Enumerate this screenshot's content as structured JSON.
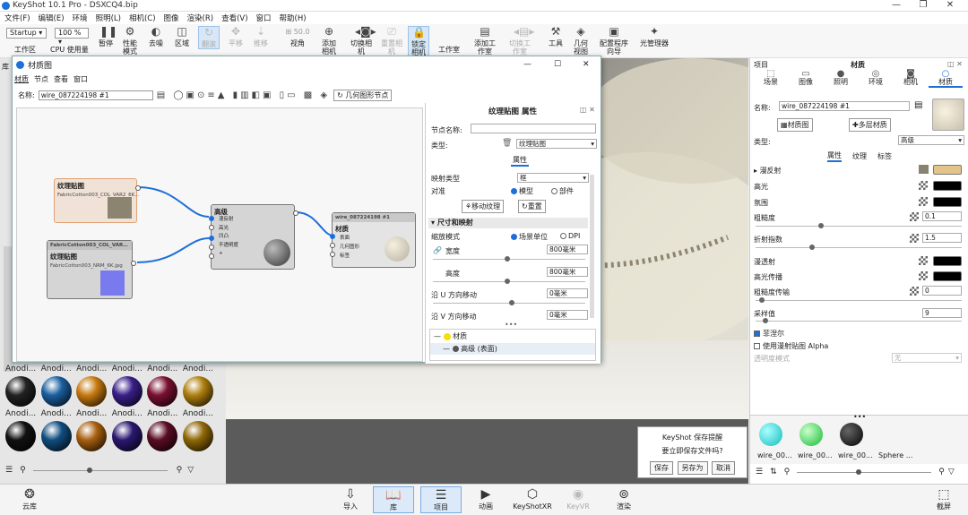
{
  "app": {
    "title": "KeyShot 10.1 Pro - DSXCQ4.bip"
  },
  "menu": [
    "文件(F)",
    "编辑(E)",
    "环境",
    "照明(L)",
    "相机(C)",
    "图像",
    "渲染(R)",
    "查看(V)",
    "窗口",
    "帮助(H)"
  ],
  "toolbar": {
    "workspace": "Startup",
    "zoom": "100 %",
    "items": [
      "工作区",
      "CPU 使用量",
      "暂停",
      "性能模式",
      "去噪",
      "区域",
      "翻滚",
      "平移",
      "推移",
      "视角",
      "添加相机",
      "切换相机",
      "重置相机",
      "锁定相机",
      "工作室",
      "添加工作室",
      "切换工作室",
      "工具",
      "几何视图",
      "配置程序向导",
      "光管理器"
    ],
    "focal": "50.0"
  },
  "material_window": {
    "title": "材质图",
    "menu": [
      "材质",
      "节点",
      "查看",
      "窗口"
    ],
    "name_label": "名称:",
    "name_value": "wire_087224198 #1",
    "geom_node": "几何图形节点",
    "nodes": {
      "texture1_title": "纹理贴图",
      "texture1_sub": "FabricCotton003_COL_VAR2_6K…",
      "texture2_header": "FabricCotton003_COL_VAR…",
      "texture2_title": "纹理贴图",
      "texture2_sub": "FabricCotton003_NRM_6K.jpg",
      "advanced_title": "高级",
      "advanced_ports": [
        "漫反射",
        "高光",
        "凹凸",
        "不透明度",
        "+"
      ],
      "output_header": "wire_087224198 #1",
      "output_title": "材质",
      "output_ports": [
        "表面",
        "几何图形",
        "标签"
      ]
    }
  },
  "props": {
    "title": "纹理贴图 属性",
    "node_name_label": "节点名称:",
    "type_label": "类型:",
    "type_value": "纹理贴图",
    "tab": "属性",
    "mapping_label": "映射类型",
    "mapping_value": "框",
    "align_label": "对准",
    "align_opt1": "模型",
    "align_opt2": "部件",
    "move_btn": "移动纹理",
    "reset_btn": "重置",
    "section": "尺寸和映射",
    "scale_label": "缩放模式",
    "scale_opt1": "场景单位",
    "scale_opt2": "DPI",
    "width_label": "宽度",
    "width_value": "800毫米",
    "height_label": "高度",
    "height_value": "800毫米",
    "u_label": "沿 U 方向移动",
    "u_value": "0毫米",
    "v_label": "沿 V 方向移动",
    "v_value": "0毫米",
    "tree1": "材质",
    "tree2": "高级 (表面)"
  },
  "right": {
    "header_left": "项目",
    "header_center": "材质",
    "tabs": [
      "场景",
      "图像",
      "照明",
      "环境",
      "相机",
      "材质"
    ],
    "name_label": "名称:",
    "name_value": "wire_087224198 #1",
    "btn_graph": "材质图",
    "btn_multi": "多层材质",
    "type_label": "类型:",
    "type_value": "高级",
    "subtabs": [
      "属性",
      "纹理",
      "标签"
    ],
    "rows": [
      {
        "label": "漫反射",
        "color": "#e3c48a"
      },
      {
        "label": "高光",
        "color": "#000000"
      },
      {
        "label": "氛围",
        "color": "#000000"
      },
      {
        "label": "粗糙度",
        "value": "0.1"
      },
      {
        "label": "折射指数",
        "value": "1.5"
      },
      {
        "label": "漫透射",
        "color": "#000000"
      },
      {
        "label": "高光传播",
        "color": "#000000"
      },
      {
        "label": "粗糙度传输",
        "value": "0"
      },
      {
        "label": "采样值",
        "value": "9"
      }
    ],
    "fresnel": "菲涅尔",
    "alpha": "使用漫射贴图 Alpha",
    "transparency": "透明度模式",
    "transparency_value": "无",
    "balls": [
      "wire_00...",
      "wire_00...",
      "wire_00...",
      "Sphere ..."
    ]
  },
  "library": {
    "labels": [
      "Anodi...",
      "Anodi...",
      "Anodi...",
      "Anodi...",
      "Anodi...",
      "Anodi..."
    ],
    "colors_row1": [
      "#222",
      "#1b5fa0",
      "#c77a10",
      "#3a1f8a",
      "#7a1030",
      "#b08010"
    ],
    "colors_row2": [
      "#111",
      "#104d80",
      "#a86010",
      "#2a1870",
      "#5a0c24",
      "#906808"
    ]
  },
  "dialog": {
    "title": "KeyShot 保存提醒",
    "message": "要立即保存文件吗?",
    "save": "保存",
    "save_as": "另存为",
    "cancel": "取消"
  },
  "bottom": {
    "cloud": "云库",
    "items": [
      "导入",
      "库",
      "项目",
      "动画",
      "KeyShotXR",
      "KeyVR",
      "渲染"
    ],
    "screenshot": "截屏"
  }
}
